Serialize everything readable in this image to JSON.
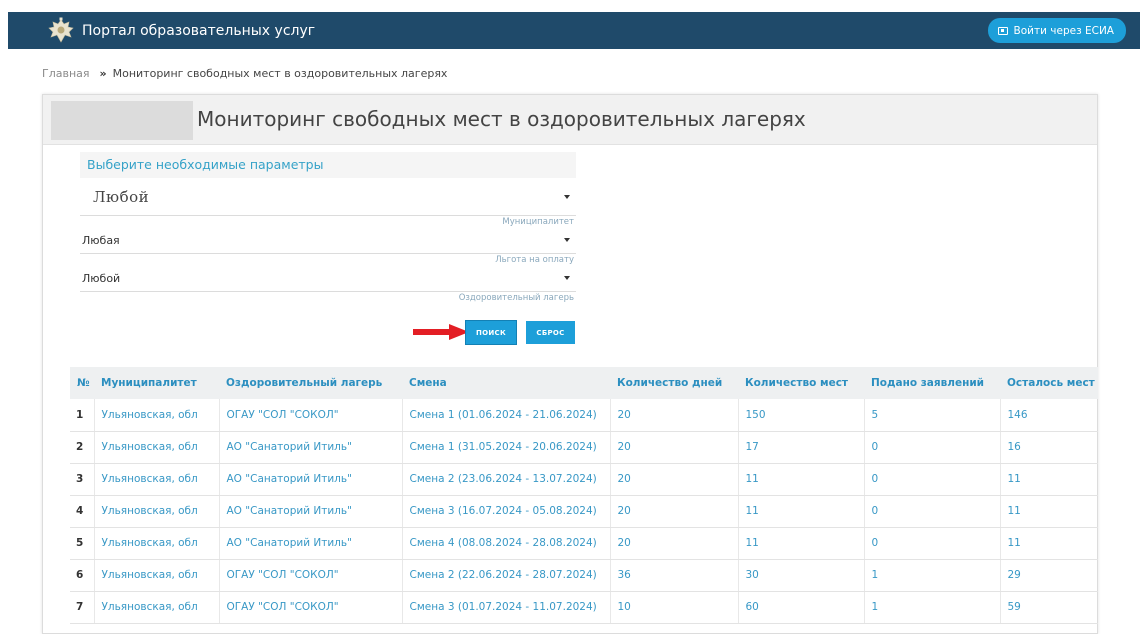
{
  "header": {
    "title": "Портал образовательных услуг",
    "login_label": "Войти через ЕСИА",
    "emblem_icon": "coat-of-arms-icon",
    "colors": {
      "bar": "#1f4a6a",
      "button": "#1d9fd9"
    }
  },
  "breadcrumb": {
    "home": "Главная",
    "separator": "»",
    "current": "Мониторинг свободных мест в оздоровительных лагерях"
  },
  "page": {
    "title": "Мониторинг свободных мест в оздоровительных лагерях"
  },
  "filters": {
    "caption": "Выберите необходимые параметры",
    "fields": [
      {
        "value": "Любой",
        "label": "Муниципалитет"
      },
      {
        "value": "Любая",
        "label": "Льгота на оплату"
      },
      {
        "value": "Любой",
        "label": "Оздоровительный лагерь"
      }
    ],
    "search_label": "ПОИСК",
    "reset_label": "СБРОС"
  },
  "table": {
    "columns": [
      "№",
      "Муниципалитет",
      "Оздоровительный лагерь",
      "Смена",
      "Количество дней",
      "Количество мест",
      "Подано заявлений",
      "Осталось мест"
    ],
    "rows": [
      [
        "1",
        "Ульяновская, обл",
        "ОГАУ \"СОЛ \"СОКОЛ\"",
        "Смена 1 (01.06.2024 - 21.06.2024)",
        "20",
        "150",
        "5",
        "146"
      ],
      [
        "2",
        "Ульяновская, обл",
        "АО \"Санаторий Итиль\"",
        "Смена 1 (31.05.2024 - 20.06.2024)",
        "20",
        "17",
        "0",
        "16"
      ],
      [
        "3",
        "Ульяновская, обл",
        "АО \"Санаторий Итиль\"",
        "Смена 2 (23.06.2024 - 13.07.2024)",
        "20",
        "11",
        "0",
        "11"
      ],
      [
        "4",
        "Ульяновская, обл",
        "АО \"Санаторий Итиль\"",
        "Смена 3 (16.07.2024 - 05.08.2024)",
        "20",
        "11",
        "0",
        "11"
      ],
      [
        "5",
        "Ульяновская, обл",
        "АО \"Санаторий Итиль\"",
        "Смена 4 (08.08.2024 - 28.08.2024)",
        "20",
        "11",
        "0",
        "11"
      ],
      [
        "6",
        "Ульяновская, обл",
        "ОГАУ \"СОЛ \"СОКОЛ\"",
        "Смена 2 (22.06.2024 - 28.07.2024)",
        "36",
        "30",
        "1",
        "29"
      ],
      [
        "7",
        "Ульяновская, обл",
        "ОГАУ \"СОЛ \"СОКОЛ\"",
        "Смена 3 (01.07.2024 - 11.07.2024)",
        "10",
        "60",
        "1",
        "59"
      ]
    ]
  }
}
